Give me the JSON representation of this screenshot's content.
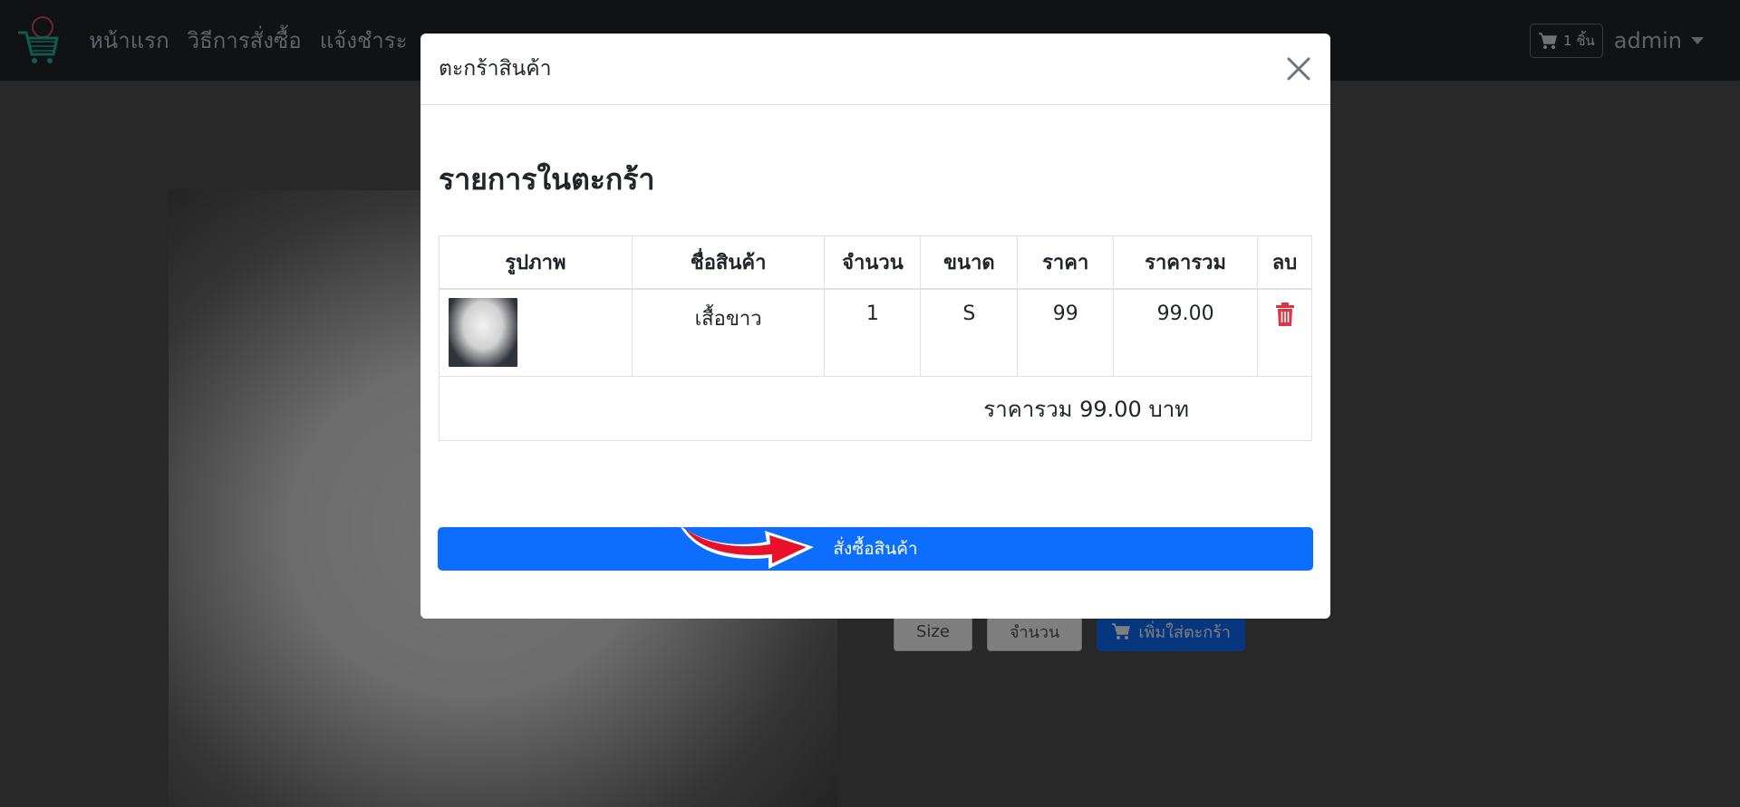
{
  "navbar": {
    "links": [
      "หน้าแรก",
      "วิธีการสั่งซื้อ",
      "แจ้งชำระ"
    ],
    "cart_count": "1 ชิ้น",
    "user": "admin"
  },
  "product": {
    "size_label": "Size",
    "quantity_label": "จำนวน",
    "add_to_cart_label": "เพิ่มใส่ตะกร้า"
  },
  "modal": {
    "title": "ตะกร้าสินค้า",
    "section_title": "รายการในตะกร้า",
    "table": {
      "headers": [
        "รูปภาพ",
        "ชื่อสินค้า",
        "จำนวน",
        "ขนาด",
        "ราคา",
        "ราคารวม",
        "ลบ"
      ],
      "rows": [
        {
          "name": "เสื้อขาว",
          "qty": "1",
          "size": "S",
          "price": "99",
          "subtotal": "99.00"
        }
      ]
    },
    "total_text": "ราคารวม 99.00 บาท",
    "order_button": "สั่งซื้อสินค้า"
  },
  "colors": {
    "primary": "#0d6efd",
    "danger": "#dc3545",
    "navbar": "#212529",
    "arrow": "#e8102a"
  }
}
